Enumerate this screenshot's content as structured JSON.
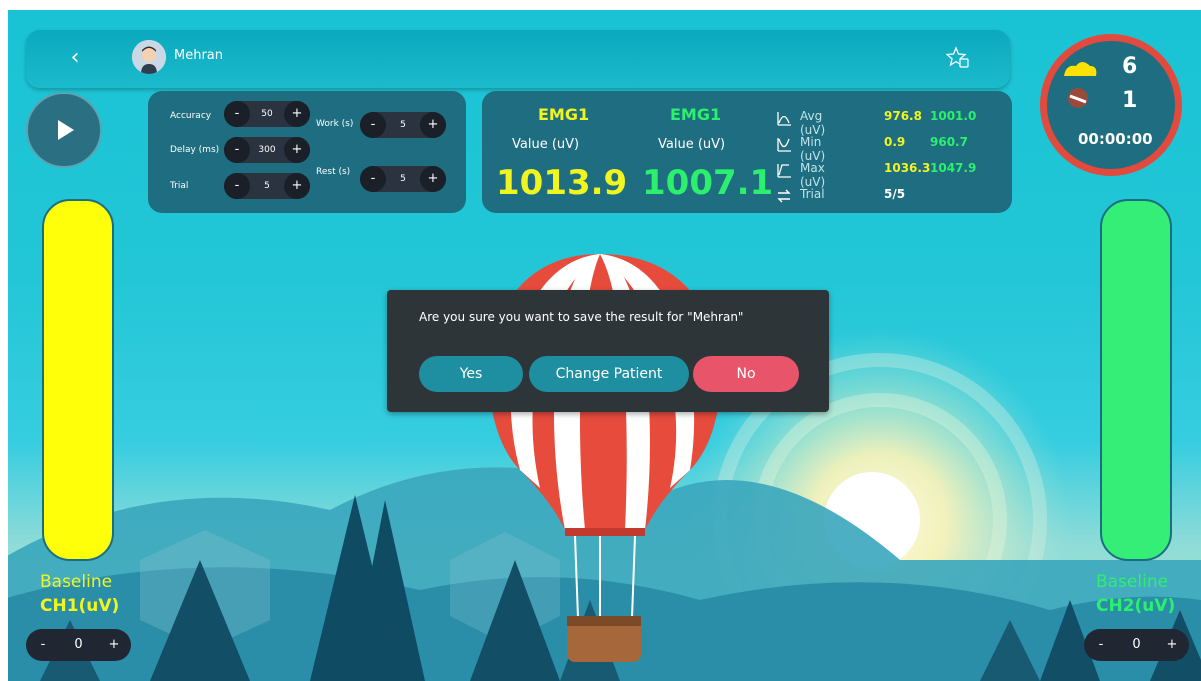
{
  "header": {
    "back_icon": "chevron-left-icon",
    "user_name": "Mehran",
    "favorite_icon": "star-badge-icon"
  },
  "settings": {
    "accuracy": {
      "label": "Accuracy",
      "value": "50"
    },
    "delay": {
      "label": "Delay (ms)",
      "value": "300"
    },
    "trial": {
      "label": "Trial",
      "value": "5"
    },
    "work": {
      "label": "Work (s)",
      "value": "5"
    },
    "rest": {
      "label": "Rest (s)",
      "value": "5"
    },
    "minus": "-",
    "plus": "+"
  },
  "emg": {
    "ch1": {
      "title": "EMG1",
      "sub": "Value (uV)",
      "value": "1013.9"
    },
    "ch2": {
      "title": "EMG1",
      "sub": "Value (uV)",
      "value": "1007.1"
    },
    "stats": {
      "avg": {
        "label": "Avg (uV)",
        "v1": "976.8",
        "v2": "1001.0"
      },
      "min": {
        "label": "Min (uV)",
        "v1": "0.9",
        "v2": "960.7"
      },
      "max": {
        "label": "Max (uV)",
        "v1": "1036.3",
        "v2": "1047.9"
      },
      "trial": {
        "label": "Trial",
        "v1": "5/5"
      }
    }
  },
  "score": {
    "top": "6",
    "bottom": "1",
    "timer": "00:00:00"
  },
  "left_channel": {
    "baseline": "Baseline",
    "label": "CH1(uV)",
    "value": "0",
    "minus": "-",
    "plus": "+"
  },
  "right_channel": {
    "baseline": "Baseline",
    "label": "CH2(uV)",
    "value": "0",
    "minus": "-",
    "plus": "+"
  },
  "dialog": {
    "message": "Are you sure you want to save the result for \"Mehran\"",
    "yes": "Yes",
    "change": "Change Patient",
    "no": "No"
  },
  "colors": {
    "ch1": "#f1f51f",
    "ch2": "#2bf06e",
    "panel": "#1e6d80",
    "yes_button": "#1e8fa0",
    "change_button": "#1e8fa0",
    "no_button": "#e8546a",
    "score_ring": "#e24a3d"
  }
}
